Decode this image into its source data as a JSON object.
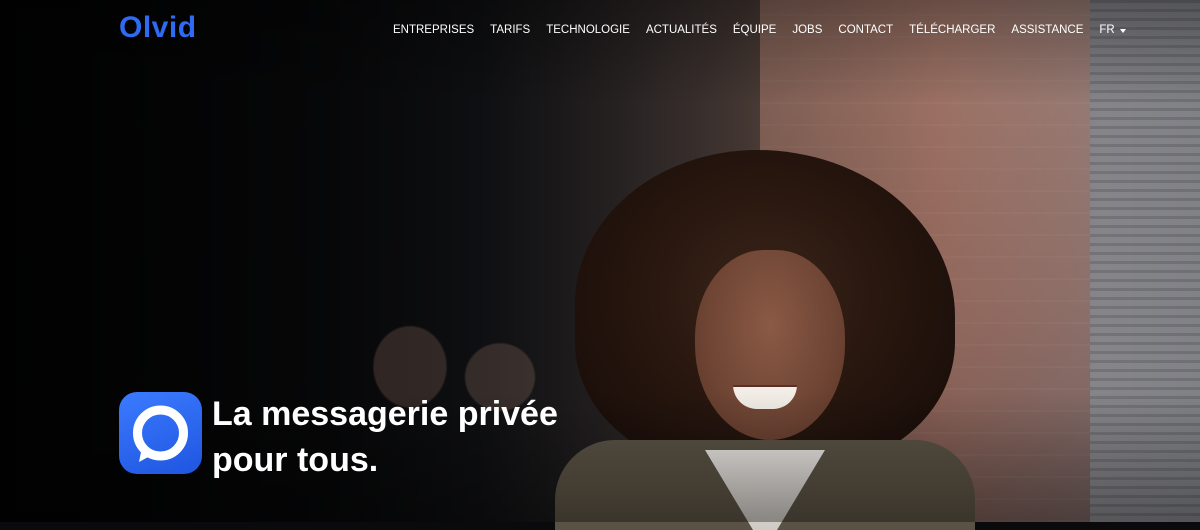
{
  "header": {
    "logo_text": "Olvid",
    "nav": [
      {
        "label": "ENTREPRISES"
      },
      {
        "label": "TARIFS"
      },
      {
        "label": "TECHNOLOGIE"
      },
      {
        "label": "ACTUALITÉS"
      },
      {
        "label": "ÉQUIPE"
      },
      {
        "label": "JOBS"
      },
      {
        "label": "CONTACT"
      },
      {
        "label": "TÉLÉCHARGER"
      },
      {
        "label": "ASSISTANCE"
      }
    ],
    "language": "FR"
  },
  "hero": {
    "app_icon": "chat-bubble-icon",
    "headline_line1": "La messagerie privée",
    "headline_line2": "pour tous."
  },
  "colors": {
    "brand": "#2f6bf2",
    "text": "#ffffff"
  }
}
